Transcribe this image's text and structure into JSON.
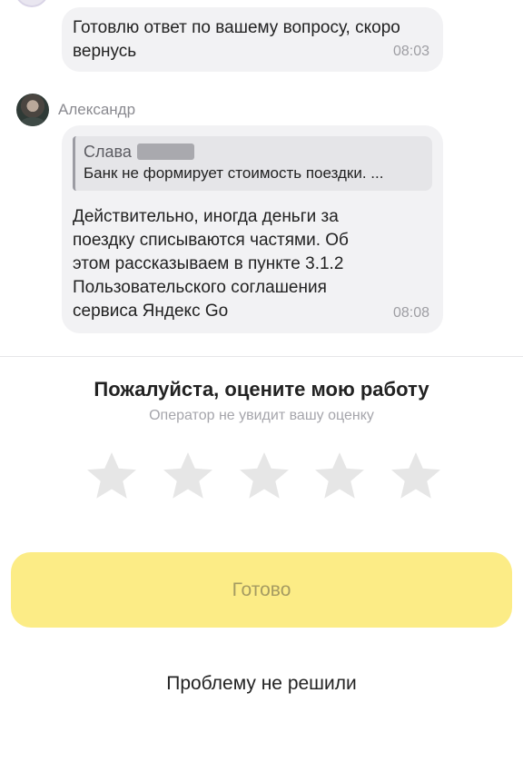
{
  "messages": [
    {
      "text": "Готовлю ответ по вашему вопросу, скоро вернусь",
      "time": "08:03"
    },
    {
      "sender": "Александр",
      "quote": {
        "name": "Слава",
        "text": "Банк не формирует стоимость поездки. ..."
      },
      "text": "Действительно, иногда деньги за поездку списываются частями. Об этом рассказываем в пункте 3.1.2 Пользовательского соглашения сервиса Яндекс Go",
      "time": "08:08"
    }
  ],
  "rating": {
    "title": "Пожалуйста, оцените мою работу",
    "subtitle": "Оператор не увидит вашу оценку",
    "max_stars": 5,
    "selected": 0,
    "star_color": "#e6e6e6"
  },
  "actions": {
    "done_label": "Готово",
    "unsolved_label": "Проблему не решили"
  },
  "colors": {
    "bubble": "#f2f2f4",
    "done_button": "#fcec86",
    "time_text": "#9e9ea3"
  }
}
